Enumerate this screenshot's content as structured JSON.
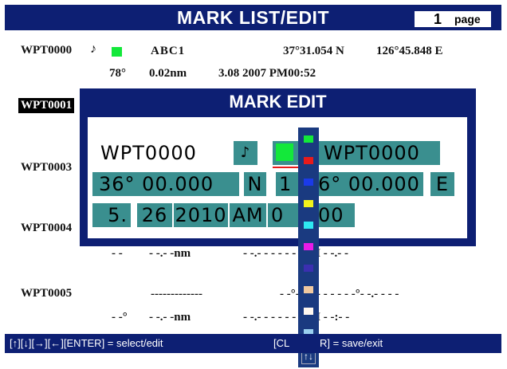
{
  "header": {
    "title": "MARK LIST/EDIT",
    "page_num": "1",
    "page_label": "page"
  },
  "list": {
    "rows": [
      {
        "name": "WPT0000",
        "label": "ABC1",
        "lat": "37°31.054 N",
        "lon": "126°45.848 E",
        "bearing": "78°",
        "dist": "0.02nm",
        "date": "3.08 2007 PM00:52"
      },
      {
        "name": "WPT0001"
      },
      {
        "name": "WPT0003"
      },
      {
        "name": "WPT0004",
        "dist": "- -.- -nm",
        "dashes": "- -",
        "date": "- -.- -   - - - -   A M - -.- -"
      },
      {
        "name": "WPT0005",
        "label": "-------------",
        "latlon": "- -°- -.- - -  -  - - -°- -.- - -  -",
        "bearing": "- -°",
        "dist": "- -.- -nm",
        "date": "- -.- -  - - - -  A M - -:- -"
      }
    ]
  },
  "modal": {
    "title": "MARK EDIT",
    "name_value": "WPT0000",
    "mark_icon": "flag-icon",
    "color_value": "#13e83a",
    "comment_value": "WPT0000",
    "lat_value": "36° 00.000",
    "lat_hem": "N",
    "lon_value": "1",
    "lon_value_tail": "6° 00.000",
    "lon_hem": "E",
    "date_month": "5.",
    "date_day": "26",
    "date_year": "2010",
    "date_ampm": "AM",
    "date_time": "0",
    "date_time_tail": "00"
  },
  "palette": {
    "colors": [
      "#13e83a",
      "#e81b1b",
      "#1b3ae8",
      "#f2f21b",
      "#2ee8f2",
      "#e81be8",
      "#3b2fb0",
      "#f0c9a0",
      "#fff8f0",
      "#9ad0f0"
    ],
    "scroll_icon": "up-down-arrow-icon",
    "scroll_glyph": "↑↓"
  },
  "footer": {
    "left_hint": "[↑][↓][→][←][ENTER] = select/edit",
    "right_hint_a": "[CL",
    "right_hint_b": "R] = save/exit"
  }
}
